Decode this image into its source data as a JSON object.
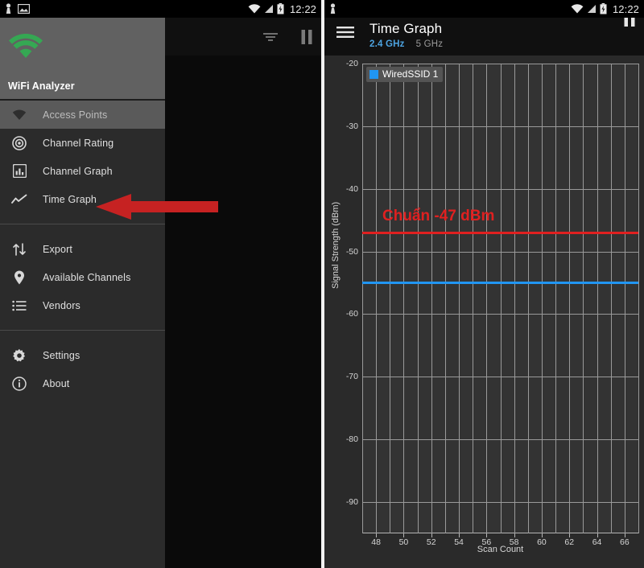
{
  "status_bar": {
    "left_icons": [
      "person-icon",
      "screenshot-image-icon"
    ],
    "wifi_icon": "wifi-icon",
    "signal_icon": "cell-signal-icon",
    "battery_icon": "battery-charging-icon",
    "time": "12:22"
  },
  "left_screen": {
    "action_bar": {
      "filter_icon": "filter-icon",
      "pause_icon": "pause-icon"
    },
    "drawer": {
      "logo_icon": "wifi-logo-icon",
      "logo_color": "#35a853",
      "app_name": "WiFi Analyzer",
      "items": [
        {
          "label": "Access Points",
          "icon": "wifi-filled-icon",
          "selected": true
        },
        {
          "label": "Channel Rating",
          "icon": "radar-icon",
          "selected": false
        },
        {
          "label": "Channel Graph",
          "icon": "bar-chart-icon",
          "selected": false
        },
        {
          "label": "Time Graph",
          "icon": "line-chart-icon",
          "selected": false
        },
        {
          "label": "Export",
          "icon": "export-arrows-icon",
          "selected": false
        },
        {
          "label": "Available Channels",
          "icon": "location-pin-icon",
          "selected": false
        },
        {
          "label": "Vendors",
          "icon": "list-icon",
          "selected": false
        },
        {
          "label": "Settings",
          "icon": "gear-icon",
          "selected": false
        },
        {
          "label": "About",
          "icon": "info-icon",
          "selected": false
        }
      ]
    },
    "annotation_arrow": {
      "icon": "red-left-arrow-icon",
      "color": "#c62222",
      "points_at": "Time Graph"
    }
  },
  "right_screen": {
    "header": {
      "menu_icon": "hamburger-menu-icon",
      "title": "Time Graph",
      "tabs": [
        {
          "label": "2.4 GHz",
          "active": true
        },
        {
          "label": "5 GHz",
          "active": false
        }
      ],
      "active_tab_color": "#4da3e0",
      "pause_icon": "pause-icon"
    },
    "annotation": {
      "text": "Chuẩn -47 dBm",
      "color": "#e02020"
    },
    "legend": [
      {
        "label": "WiredSSID 1",
        "color": "#2196f3"
      }
    ]
  },
  "chart_data": {
    "type": "line",
    "title": "Time Graph",
    "xlabel": "Scan Count",
    "ylabel": "Signal Strength (dBm)",
    "xlim": [
      47,
      67
    ],
    "ylim": [
      -95,
      -20
    ],
    "grid": true,
    "legend_position": "top-left",
    "yticks": [
      -20,
      -30,
      -40,
      -50,
      -60,
      -70,
      -80,
      -90
    ],
    "xticks": [
      48,
      50,
      52,
      54,
      56,
      58,
      60,
      62,
      64,
      66
    ],
    "x_minor_step": 1,
    "series": [
      {
        "name": "WiredSSID 1",
        "color": "#2196f3",
        "x": [
          47,
          48,
          49,
          50,
          51,
          52,
          53,
          54,
          55,
          56,
          57,
          58,
          59,
          60,
          61,
          62,
          63,
          64,
          65,
          66,
          67
        ],
        "values": [
          -55,
          -55,
          -55,
          -55,
          -55,
          -55,
          -55,
          -55,
          -55,
          -55,
          -55,
          -55,
          -55,
          -55,
          -55,
          -55,
          -55,
          -55,
          -55,
          -55,
          -55
        ]
      },
      {
        "name": "Chuẩn -47 dBm",
        "color": "#e02020",
        "annotation_line": true,
        "x": [
          47,
          67
        ],
        "values": [
          -47,
          -47
        ]
      }
    ]
  }
}
